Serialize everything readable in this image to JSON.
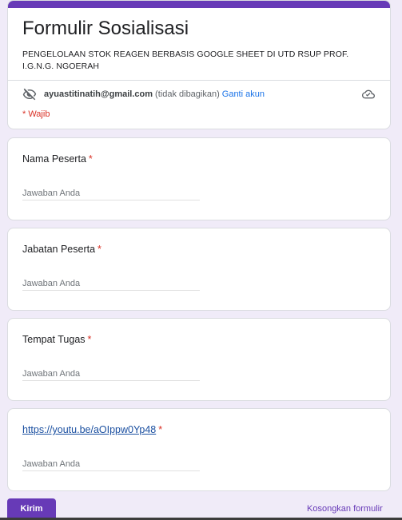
{
  "form": {
    "title": "Formulir Sosialisasi",
    "description": "PENGELOLAAN STOK REAGEN BERBASIS GOOGLE SHEET DI UTD RSUP PROF. I.G.N.G. NGOERAH",
    "accent_color": "#673ab7"
  },
  "account": {
    "email": "ayuastitinatih@gmail.com",
    "note": "(tidak dibagikan)",
    "switch_label": "Ganti akun",
    "icon": "eye-off-icon",
    "status_icon": "cloud-check-icon"
  },
  "required_note": "* Wajib",
  "questions": [
    {
      "label": "Nama Peserta",
      "required_mark": "*",
      "placeholder": "Jawaban Anda"
    },
    {
      "label": "Jabatan Peserta",
      "required_mark": "*",
      "placeholder": "Jawaban Anda"
    },
    {
      "label": "Tempat Tugas",
      "required_mark": "*",
      "placeholder": "Jawaban Anda"
    },
    {
      "label": "https://youtu.be/aOIppw0Yp48",
      "required_mark": "*",
      "placeholder": "Jawaban Anda"
    }
  ],
  "actions": {
    "submit_label": "Kirim",
    "clear_label": "Kosongkan formulir"
  }
}
